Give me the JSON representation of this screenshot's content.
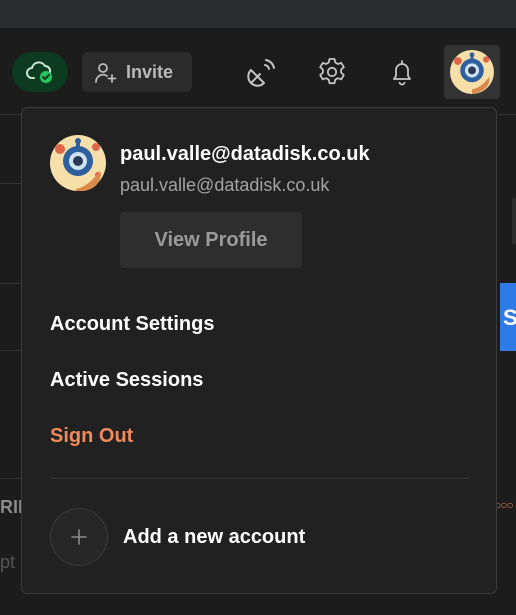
{
  "toolbar": {
    "invite_label": "Invite",
    "icons": [
      "cloud-sync-icon",
      "user-add-icon",
      "broadcast-icon",
      "gear-icon",
      "bell-icon",
      "avatar-icon"
    ]
  },
  "background": {
    "partial_button_letter": "S",
    "partial_header_text": "RIP",
    "partial_placeholder_text": "pt"
  },
  "account_menu": {
    "name": "paul.valle@datadisk.co.uk",
    "email": "paul.valle@datadisk.co.uk",
    "view_profile_label": "View Profile",
    "items": [
      {
        "label": "Account Settings"
      },
      {
        "label": "Active Sessions"
      },
      {
        "label": "Sign Out"
      }
    ],
    "add_account_label": "Add a new account"
  },
  "colors": {
    "background": "#1c1c1c",
    "panel": "#212121",
    "sign_out": "#ef8a5c",
    "cloud_status": "#22c55e",
    "accent_blue": "#2f7be5"
  }
}
